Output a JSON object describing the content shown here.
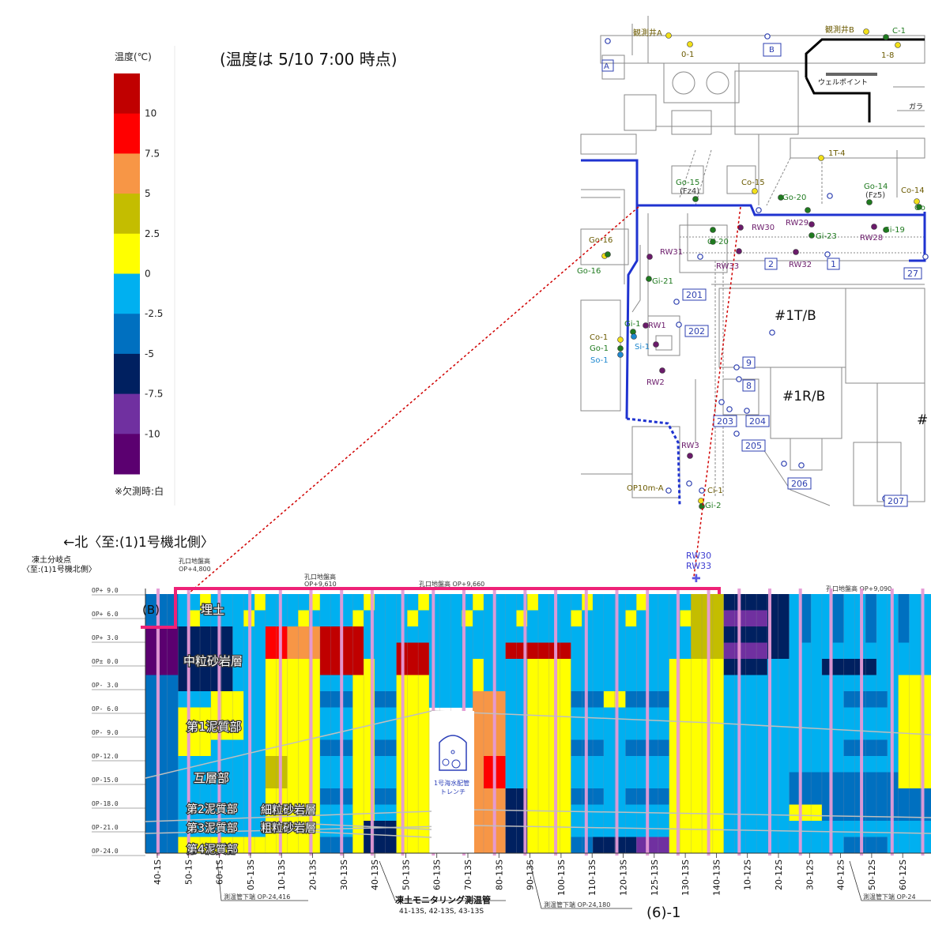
{
  "legend": {
    "title": "温度(℃)",
    "ticks": [
      "10",
      "7.5",
      "5",
      "2.5",
      "0",
      "-2.5",
      "-5",
      "-7.5",
      "-10"
    ],
    "note": "※欠測時:白",
    "colors": [
      "#c00000",
      "#ff0000",
      "#f79646",
      "#c4bd00",
      "#ffff00",
      "#00b0f0",
      "#0070c0",
      "#002060",
      "#7030a0",
      "#5b0070"
    ]
  },
  "timestamp": "(温度は 5/10 7:00 時点)",
  "map": {
    "wells": [
      "観測井A",
      "観測井B",
      "C-1",
      "0-1",
      "1-8",
      "1T-4",
      "A",
      "B",
      "Co-15",
      "Co-14",
      "Go-15",
      "(Fz4)",
      "Go-20",
      "Go-14",
      "(Fz5)",
      "Go",
      "Go-16",
      "Go-16",
      "RW30",
      "RW29",
      "Gi-23",
      "Gi-19",
      "RW28",
      "Gi-20",
      "RW31",
      "RW33",
      "RW32",
      "Gi-21",
      "RW1",
      "Gi-1",
      "Co-1",
      "Go-1",
      "So-1",
      "Si-1",
      "RW2",
      "RW3",
      "Ci-1",
      "Gi-2",
      "OP10m-A"
    ],
    "markers": [
      "2",
      "1",
      "27",
      "201",
      "202",
      "9",
      "8",
      "203",
      "204",
      "205",
      "206",
      "207"
    ],
    "buildings": [
      "#1T/B",
      "#1R/B",
      "#"
    ],
    "labels": [
      "ウェルポイント",
      "ガラ"
    ]
  },
  "section": {
    "title": "←北〈至:(1)1号機北側〉",
    "branch_label": [
      "凍土分岐点",
      "〈至:(1)1号機北側〉"
    ],
    "b_label": "(B)",
    "rw_label": [
      "RW30",
      "RW33"
    ],
    "ground_labels": [
      "孔口地盤高",
      "OP+4,800",
      "孔口地盤高",
      "OP+9,610",
      "孔口地盤高 OP+9,660",
      "孔口地盤高 OP+9,090"
    ],
    "y_labels": [
      "OP+ 9.0",
      "OP+ 6.0",
      "OP+ 3.0",
      "OP± 0.0",
      "OP- 3.0",
      "OP- 6.0",
      "OP- 9.0",
      "OP-12.0",
      "OP-15.0",
      "OP-18.0",
      "OP-21.0",
      "OP-24.0"
    ],
    "layers": [
      "埋土",
      "中粒砂岩層",
      "第1泥質部",
      "互層部",
      "第2泥質部",
      "第3泥質部",
      "第4泥質部",
      "細粒砂岩層",
      "粗粒砂岩層"
    ],
    "trench": [
      "1号海水配管",
      "トレンチ"
    ],
    "pipes": [
      "40-1S",
      "50-1S",
      "60-1S",
      "05-13S",
      "10-13S",
      "20-13S",
      "30-13S",
      "40-13S",
      "50-13S",
      "60-13S",
      "70-13S",
      "80-13S",
      "90-13S",
      "100-13S",
      "110-13S",
      "120-13S",
      "125-13S",
      "130-13S",
      "140-13S",
      "10-12S",
      "20-12S",
      "30-12S",
      "40-12S",
      "50-12S",
      "60-12S"
    ],
    "footnotes": [
      "測温管下端 OP-24,416",
      "凍土モニタリング測温管",
      "41-13S, 42-13S, 43-13S",
      "測温管下端 OP-24,180",
      "測温管下端 OP-24"
    ],
    "bottom_label": "(6)-1"
  }
}
